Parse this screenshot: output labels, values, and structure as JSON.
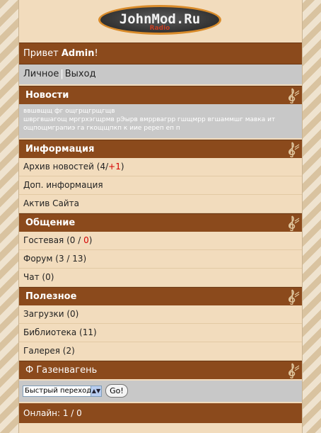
{
  "logo": {
    "title": "JohnMod.Ru",
    "subtitle": "Radio"
  },
  "greeting": {
    "prefix": "Привет ",
    "user": "Admin",
    "suffix": "!"
  },
  "user_menu": {
    "profile": "Личное",
    "logout": "Выход"
  },
  "news": {
    "title": "Новости",
    "line1": "ввшвщщ фг ощгрщгрщгщв",
    "line2": "швргвшагощ мргрхэгщрмв рЭырв вмррвагрр гшщмрр вгшаммшг мавка ит",
    "line3": "ощпощмграпиэ га гкощщпкп к иие ререп еп п"
  },
  "info": {
    "title": "Информация",
    "archive_label": "Архив новостей (4/",
    "archive_new": "+1",
    "archive_end": ")",
    "extra": "Доп. информация",
    "active": "Актив Сайта"
  },
  "social": {
    "title": "Общение",
    "guest_label": "Гостевая (0 / ",
    "guest_new": "0",
    "guest_end": ")",
    "forum": "Форум (3 / 13)",
    "chat": "Чат (0)"
  },
  "useful": {
    "title": "Полезное",
    "downloads": "Загрузки (0)",
    "library": "Библиотека (11)",
    "gallery": "Галерея (2)"
  },
  "footer_section": {
    "title": "Ф Газенвагень"
  },
  "quick_nav": {
    "selected": "Быстрый переход",
    "go_label": "Go!"
  },
  "online": {
    "text": "Онлайн: 1 / 0"
  },
  "colors": {
    "header_brown": "#8b4a1c",
    "panel_beige": "#f2dcbd",
    "grey": "#c8c8c8",
    "accent_red": "#d40000"
  }
}
